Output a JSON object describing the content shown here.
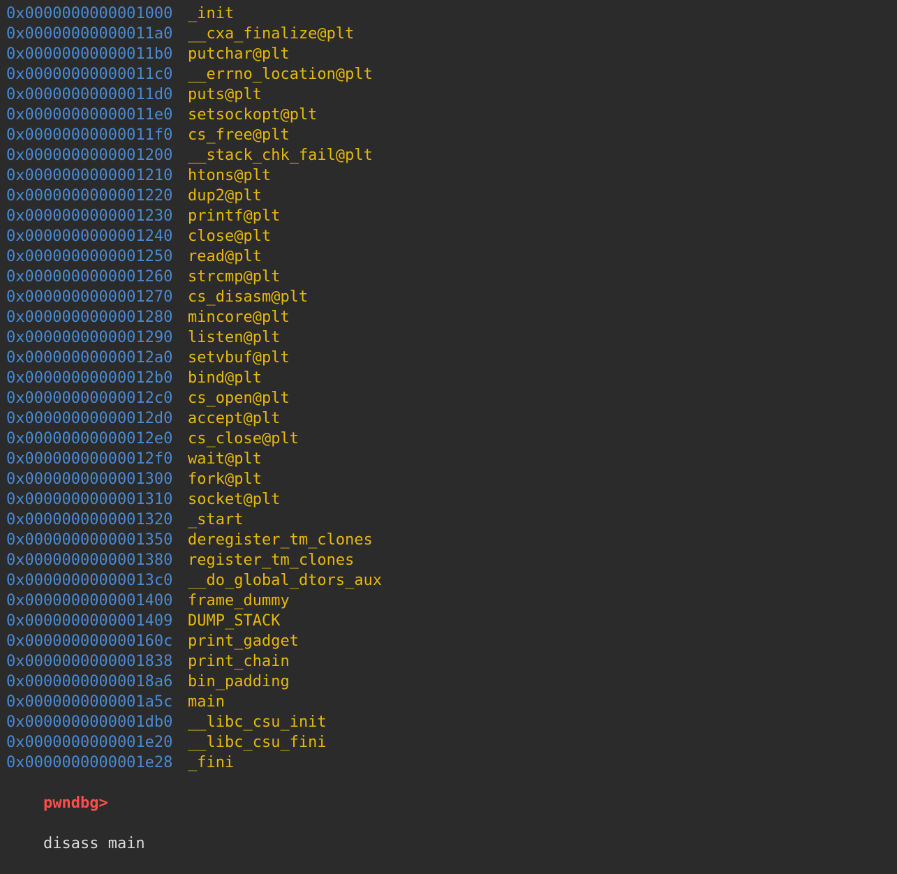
{
  "colors": {
    "background": "#2b2b2b",
    "address": "#4a8ad3",
    "symbol": "#e5b80b",
    "prompt": "#ff4d4d",
    "command": "#dcdcdc"
  },
  "rows": [
    {
      "addr": "0x0000000000001000",
      "sym": "_init"
    },
    {
      "addr": "0x00000000000011a0",
      "sym": "__cxa_finalize@plt"
    },
    {
      "addr": "0x00000000000011b0",
      "sym": "putchar@plt"
    },
    {
      "addr": "0x00000000000011c0",
      "sym": "__errno_location@plt"
    },
    {
      "addr": "0x00000000000011d0",
      "sym": "puts@plt"
    },
    {
      "addr": "0x00000000000011e0",
      "sym": "setsockopt@plt"
    },
    {
      "addr": "0x00000000000011f0",
      "sym": "cs_free@plt"
    },
    {
      "addr": "0x0000000000001200",
      "sym": "__stack_chk_fail@plt"
    },
    {
      "addr": "0x0000000000001210",
      "sym": "htons@plt"
    },
    {
      "addr": "0x0000000000001220",
      "sym": "dup2@plt"
    },
    {
      "addr": "0x0000000000001230",
      "sym": "printf@plt"
    },
    {
      "addr": "0x0000000000001240",
      "sym": "close@plt"
    },
    {
      "addr": "0x0000000000001250",
      "sym": "read@plt"
    },
    {
      "addr": "0x0000000000001260",
      "sym": "strcmp@plt"
    },
    {
      "addr": "0x0000000000001270",
      "sym": "cs_disasm@plt"
    },
    {
      "addr": "0x0000000000001280",
      "sym": "mincore@plt"
    },
    {
      "addr": "0x0000000000001290",
      "sym": "listen@plt"
    },
    {
      "addr": "0x00000000000012a0",
      "sym": "setvbuf@plt"
    },
    {
      "addr": "0x00000000000012b0",
      "sym": "bind@plt"
    },
    {
      "addr": "0x00000000000012c0",
      "sym": "cs_open@plt"
    },
    {
      "addr": "0x00000000000012d0",
      "sym": "accept@plt"
    },
    {
      "addr": "0x00000000000012e0",
      "sym": "cs_close@plt"
    },
    {
      "addr": "0x00000000000012f0",
      "sym": "wait@plt"
    },
    {
      "addr": "0x0000000000001300",
      "sym": "fork@plt"
    },
    {
      "addr": "0x0000000000001310",
      "sym": "socket@plt"
    },
    {
      "addr": "0x0000000000001320",
      "sym": "_start"
    },
    {
      "addr": "0x0000000000001350",
      "sym": "deregister_tm_clones"
    },
    {
      "addr": "0x0000000000001380",
      "sym": "register_tm_clones"
    },
    {
      "addr": "0x00000000000013c0",
      "sym": "__do_global_dtors_aux"
    },
    {
      "addr": "0x0000000000001400",
      "sym": "frame_dummy"
    },
    {
      "addr": "0x0000000000001409",
      "sym": "DUMP_STACK"
    },
    {
      "addr": "0x000000000000160c",
      "sym": "print_gadget"
    },
    {
      "addr": "0x0000000000001838",
      "sym": "print_chain"
    },
    {
      "addr": "0x00000000000018a6",
      "sym": "bin_padding"
    },
    {
      "addr": "0x0000000000001a5c",
      "sym": "main"
    },
    {
      "addr": "0x0000000000001db0",
      "sym": "__libc_csu_init"
    },
    {
      "addr": "0x0000000000001e20",
      "sym": "__libc_csu_fini"
    },
    {
      "addr": "0x0000000000001e28",
      "sym": "_fini"
    }
  ],
  "prompt": {
    "label": "pwndbg>",
    "command": "disass main"
  }
}
